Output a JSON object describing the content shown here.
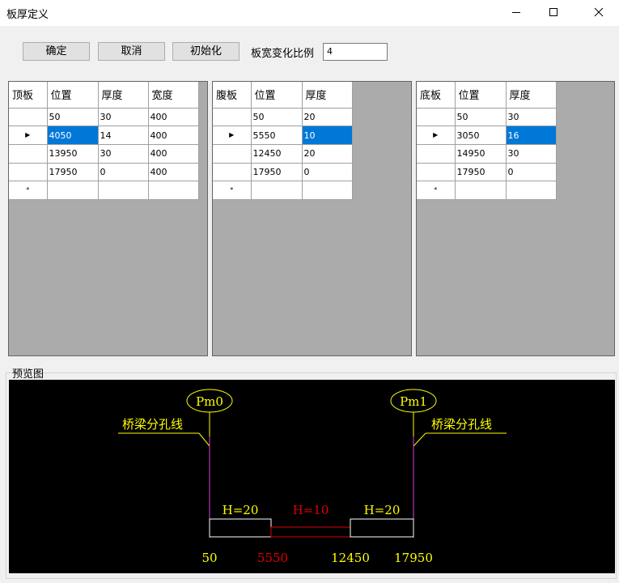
{
  "window": {
    "title": "板厚定义",
    "minimize_icon": "minimize-icon",
    "maximize_icon": "maximize-icon",
    "close_icon": "close-icon"
  },
  "toolbar": {
    "ok_label": "确定",
    "cancel_label": "取消",
    "init_label": "初始化",
    "ratio_label": "板宽变化比例",
    "ratio_value": "4"
  },
  "grids": {
    "top": {
      "headers": [
        "顶板",
        "位置",
        "厚度",
        "宽度"
      ],
      "rows": [
        [
          "50",
          "30",
          "400"
        ],
        [
          "4050",
          "14",
          "400"
        ],
        [
          "13950",
          "30",
          "400"
        ],
        [
          "17950",
          "0",
          "400"
        ]
      ],
      "current_row_marker": "▶",
      "new_row_marker": "*"
    },
    "web": {
      "headers": [
        "腹板",
        "位置",
        "厚度"
      ],
      "rows": [
        [
          "50",
          "20"
        ],
        [
          "5550",
          "10"
        ],
        [
          "12450",
          "20"
        ],
        [
          "17950",
          "0"
        ]
      ],
      "current_row_marker": "▶",
      "new_row_marker": "*"
    },
    "bottom": {
      "headers": [
        "底板",
        "位置",
        "厚度"
      ],
      "rows": [
        [
          "50",
          "30"
        ],
        [
          "3050",
          "16"
        ],
        [
          "14950",
          "30"
        ],
        [
          "17950",
          "0"
        ]
      ],
      "current_row_marker": "▶",
      "new_row_marker": "*"
    }
  },
  "preview": {
    "label": "预览图",
    "pier_left": "Pm0",
    "pier_right": "Pm1",
    "division_label_left": "桥梁分孔线",
    "division_label_right": "桥梁分孔线",
    "segments": [
      "H=20",
      "H=10",
      "H=20"
    ],
    "positions": [
      "50",
      "5550",
      "12450",
      "17950"
    ],
    "colors": {
      "yellow": "#ffff00",
      "red": "#e00000",
      "magenta": "#e040e0",
      "white": "#ffffff"
    }
  }
}
